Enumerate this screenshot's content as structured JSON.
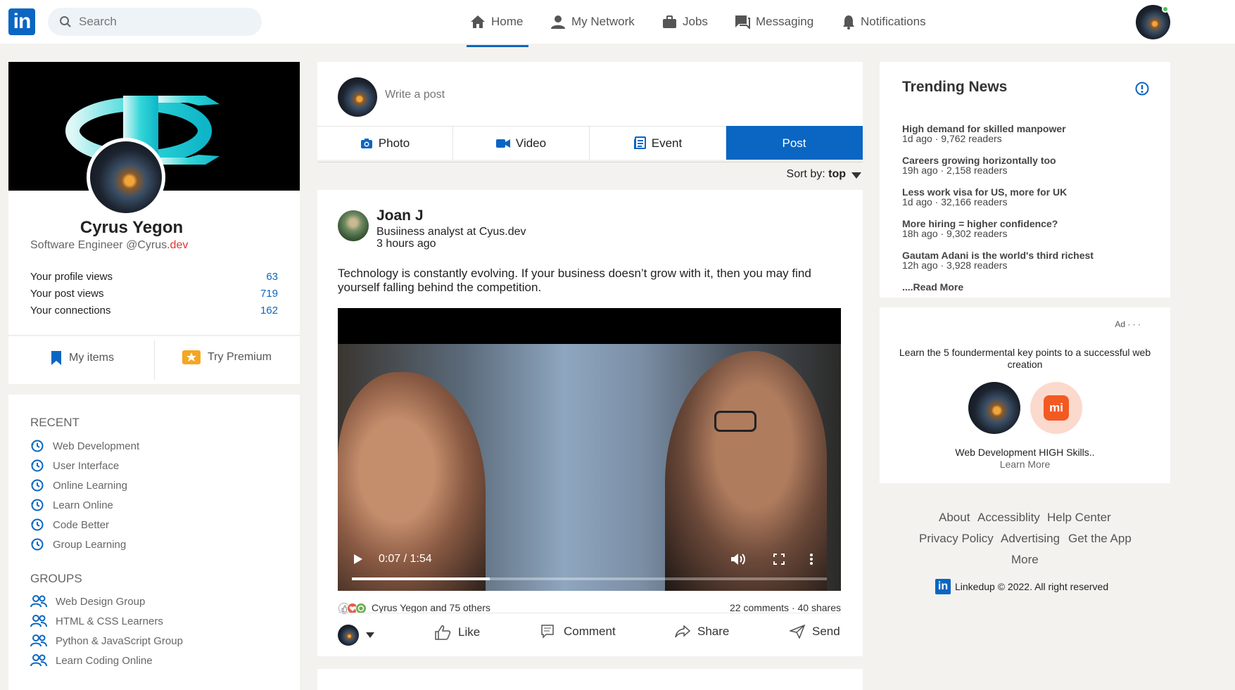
{
  "nav": {
    "logo": "in",
    "search_placeholder": "Search",
    "items": [
      {
        "label": "Home",
        "icon": "home-icon"
      },
      {
        "label": "My Network",
        "icon": "network-icon"
      },
      {
        "label": "Jobs",
        "icon": "briefcase-icon"
      },
      {
        "label": "Messaging",
        "icon": "messaging-icon"
      },
      {
        "label": "Notifications",
        "icon": "bell-icon"
      }
    ],
    "active": "Home"
  },
  "profile": {
    "name": "Cyrus Yegon",
    "title_prefix": "Software Engineer @Cyrus.",
    "title_suffix": "dev",
    "stats": [
      {
        "label": "Your profile views",
        "value": "63"
      },
      {
        "label": "Your post views",
        "value": "719"
      },
      {
        "label": "Your connections",
        "value": "162"
      }
    ],
    "my_items": "My items",
    "try_premium": "Try Premium"
  },
  "sidebar": {
    "recent_heading": "RECENT",
    "recent": [
      "Web Development",
      "User Interface",
      "Online Learning",
      "Learn Online",
      "Code Better",
      "Group Learning"
    ],
    "groups_heading": "GROUPS",
    "groups": [
      "Web Design Group",
      "HTML & CSS Learners",
      "Python & JavaScript Group",
      "Learn Coding Online"
    ]
  },
  "composer": {
    "placeholder": "Write a post",
    "tabs": [
      "Photo",
      "Video",
      "Event",
      "Post"
    ]
  },
  "sort": {
    "label": "Sort by:",
    "value": "top"
  },
  "post": {
    "author": "Joan J",
    "subtitle": "Busiiness analyst at Cyus.dev",
    "time": "3 hours ago",
    "text": "Technology is constantly evolving. If your business doesn’t grow with it, then you may find yourself falling behind the competition.",
    "video": {
      "time": "0:07 / 1:54",
      "progress": 0.29
    },
    "reactions_label": "Cyrus Yegon and 75 others",
    "comments": "22 comments",
    "shares": "40 shares",
    "actions": [
      "Like",
      "Comment",
      "Share",
      "Send"
    ]
  },
  "trending": {
    "heading": "Trending News",
    "items": [
      {
        "title": "High demand for skilled manpower",
        "meta": "1d ago · 9,762 readers"
      },
      {
        "title": "Careers growing horizontally too",
        "meta": "19h ago · 2,158 readers"
      },
      {
        "title": "Less work visa for US, more for UK",
        "meta": "1d ago · 32,166 readers"
      },
      {
        "title": "More hiring = higher confidence?",
        "meta": "18h ago · 9,302 readers"
      },
      {
        "title": "Gautam Adani is the world's third richest",
        "meta": "12h ago · 3,928 readers"
      }
    ],
    "read_more": "....Read More"
  },
  "ad": {
    "label": "Ad · · ·",
    "text": "Learn the 5 foundermental key points to a successful web creation",
    "title": "Web Development HIGH Skills..",
    "learn_more": "Learn More",
    "brand": "mi"
  },
  "footer": {
    "links": [
      "About",
      "Accessiblity",
      "Help Center",
      "Privacy Policy",
      "Advertising",
      "Get the App",
      "More"
    ],
    "logo": "in",
    "copyright": "Linkedup © 2022. All right reserved"
  },
  "colors": {
    "accent": "#0a66c2",
    "background": "#f3f2ef",
    "dev_red": "#e03131"
  }
}
